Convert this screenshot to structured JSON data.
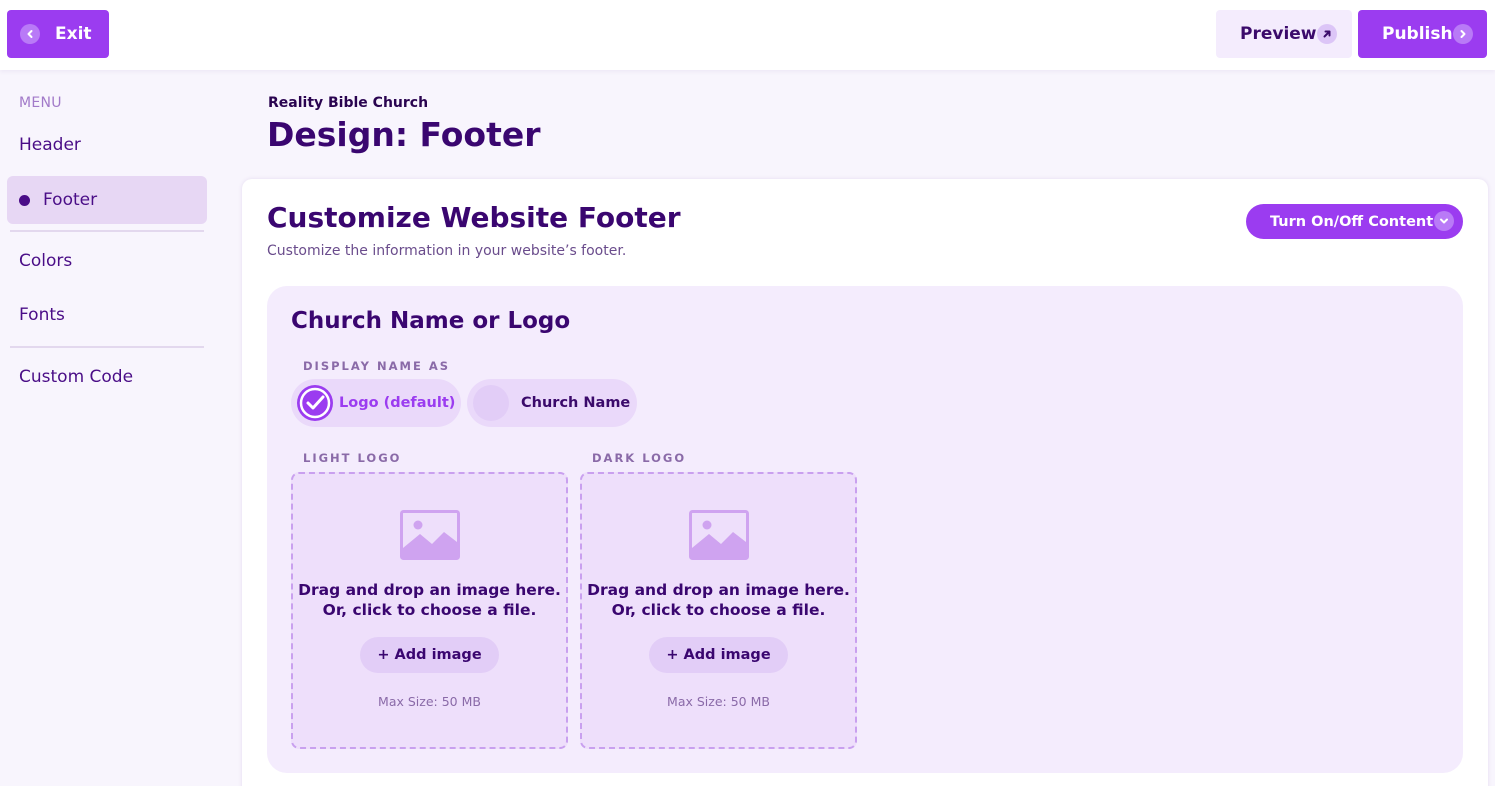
{
  "topbar": {
    "exit_label": "Exit",
    "preview_label": "Preview",
    "publish_label": "Publish"
  },
  "sidebar": {
    "menu_label": "MENU",
    "items": [
      {
        "label": "Header",
        "active": false
      },
      {
        "label": "Footer",
        "active": true
      },
      {
        "label": "Colors",
        "active": false
      },
      {
        "label": "Fonts",
        "active": false
      },
      {
        "label": "Custom Code",
        "active": false
      }
    ]
  },
  "main": {
    "church_name": "Reality Bible Church",
    "page_title": "Design: Footer",
    "card": {
      "title": "Customize Website Footer",
      "subtitle": "Customize the information in your website’s footer.",
      "toggle_label": "Turn On/Off Content",
      "section": {
        "title": "Church Name or Logo",
        "display_label": "DISPLAY NAME AS",
        "options": [
          {
            "label": "Logo (default)",
            "selected": true
          },
          {
            "label": "Church Name",
            "selected": false
          }
        ],
        "light_logo": {
          "label": "LIGHT LOGO",
          "line1": "Drag and drop an image here.",
          "line2": "Or, click to choose a file.",
          "button": "+ Add image",
          "max": "Max Size: 50 MB"
        },
        "dark_logo": {
          "label": "DARK LOGO",
          "line1": "Drag and drop an image here.",
          "line2": "Or, click to choose a file.",
          "button": "+ Add image",
          "max": "Max Size: 50 MB"
        }
      }
    }
  },
  "colors": {
    "accent": "#9b3cf0",
    "text_dark": "#3a0670",
    "section_bg": "#f4ecfd"
  }
}
